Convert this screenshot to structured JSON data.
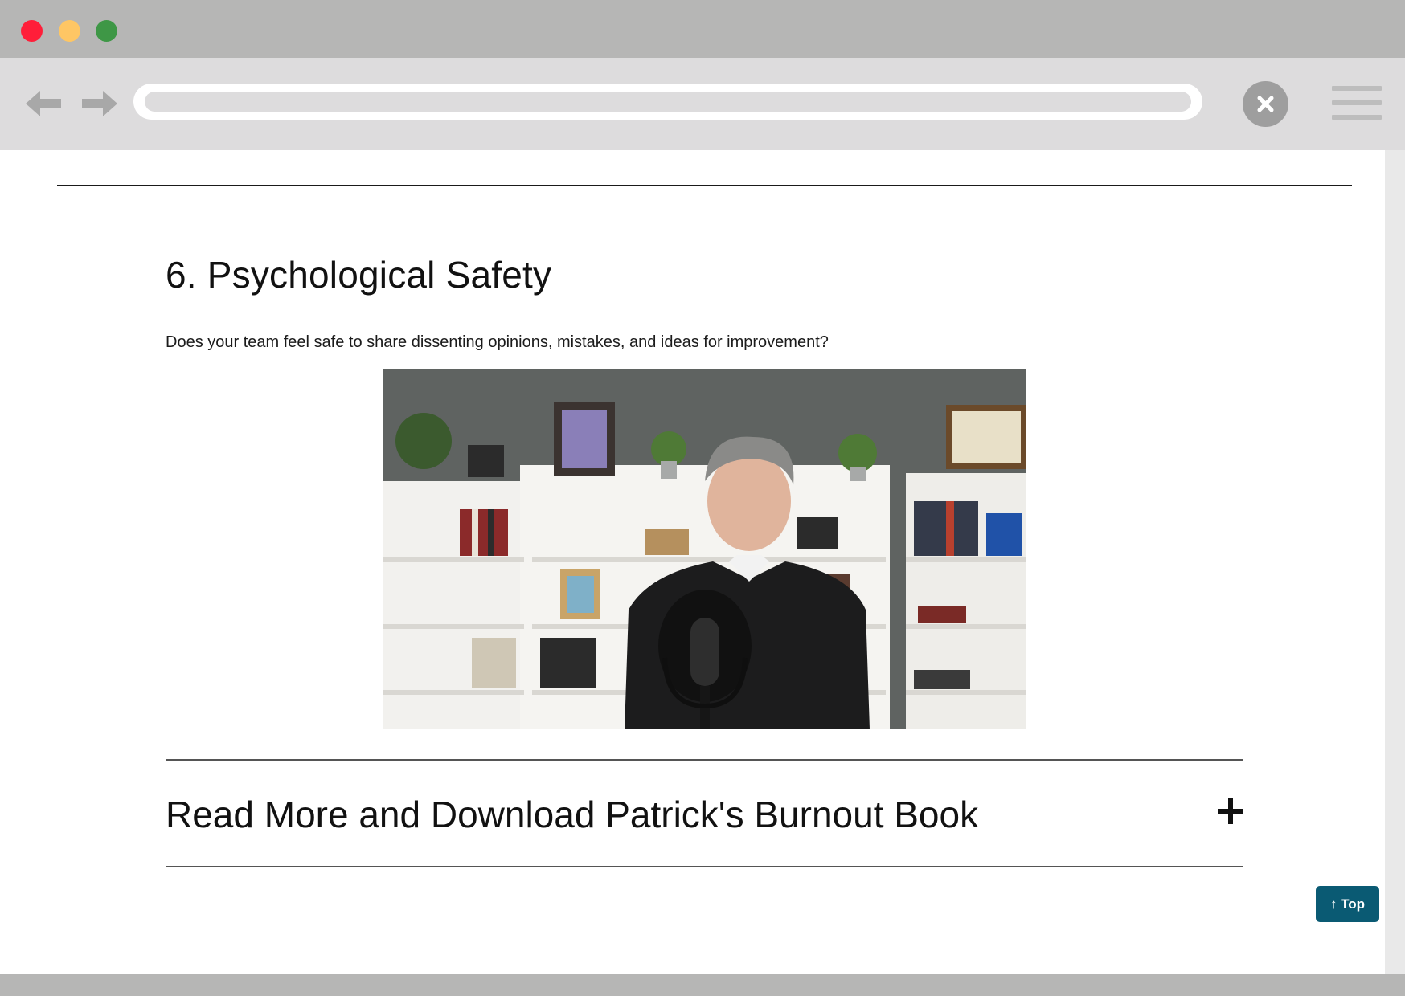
{
  "window": {
    "controls": [
      "close",
      "minimize",
      "maximize"
    ]
  },
  "toolbar": {
    "back_icon": "arrow-left-icon",
    "forward_icon": "arrow-right-icon",
    "address": "",
    "close_icon": "close-icon",
    "menu_icon": "hamburger-menu-icon"
  },
  "section": {
    "title": "6. Psychological Safety",
    "description": "Does your team feel safe to share dissenting opinions, mistakes, and ideas for improvement?"
  },
  "accordion": {
    "title": "Read More and Download Patrick's Burnout Book",
    "icon": "plus-icon"
  },
  "back_to_top": {
    "label": "↑ Top"
  },
  "colors": {
    "chrome": "#b6b6b5",
    "toolbar": "#dddcdd",
    "accent": "#0a5a73"
  }
}
